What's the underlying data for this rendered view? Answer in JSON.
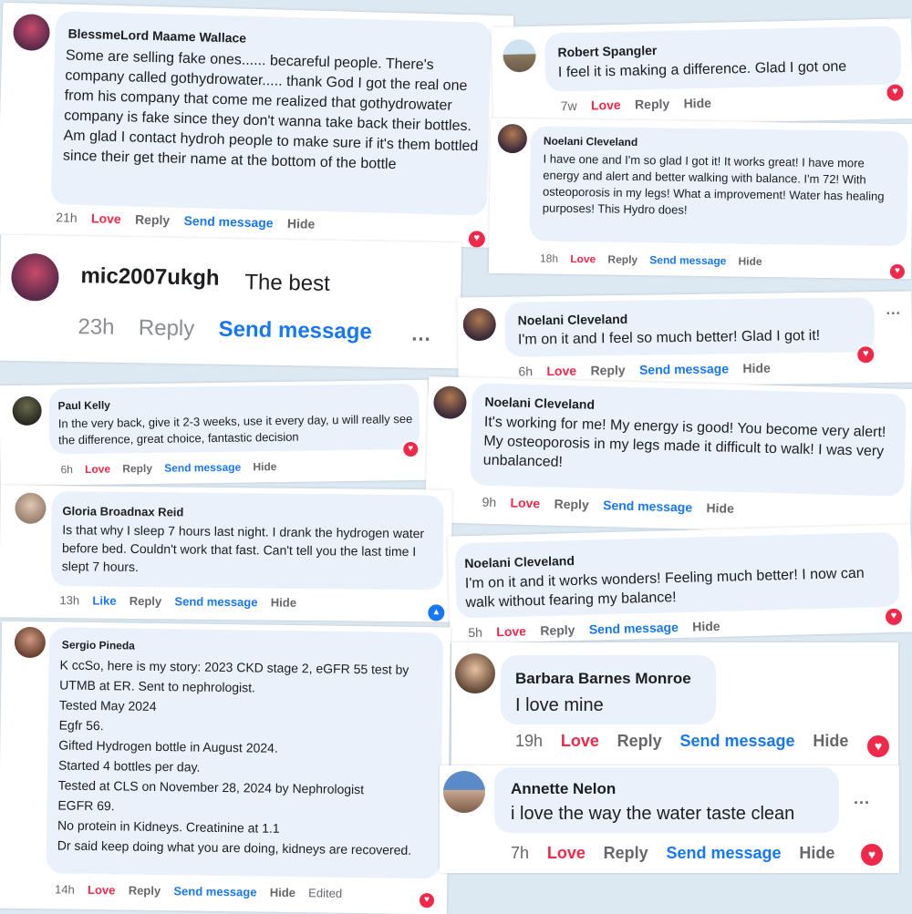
{
  "comments": [
    {
      "name": "BlessmeLord Maame Wallace",
      "text": "Some are selling fake ones...... becareful people. There's company called gothydrowater..... thank God I got the real one from his company that come me realized that gothydrowater company is fake since they don't wanna take back their bottles. Am glad I contact hydroh people to make sure if it's them bottled since their get their name at the bottom of the bottle",
      "time": "21h",
      "react": "Love",
      "reply": "Reply",
      "send": "Send message",
      "hide": "Hide"
    },
    {
      "name": "Robert Spangler",
      "text": "I feel it is making a difference. Glad I got one",
      "time": "7w",
      "react": "Love",
      "reply": "Reply",
      "hide": "Hide"
    },
    {
      "name": "Noelani Cleveland",
      "text": "I have one and I'm so glad I got it! It works great! I have more energy and alert and better walking with balance. I'm 72! With osteoporosis in my legs! What a improvement! Water has healing purposes! This Hydro does!",
      "time": "18h",
      "react": "Love",
      "reply": "Reply",
      "send": "Send message",
      "hide": "Hide"
    },
    {
      "name": "mic2007ukgh",
      "text": "The best",
      "time": "23h",
      "reply": "Reply",
      "send": "Send message",
      "more": "..."
    },
    {
      "name": "Noelani Cleveland",
      "text": "I'm on it and I feel so much better! Glad I got it!",
      "time": "6h",
      "react": "Love",
      "reply": "Reply",
      "send": "Send message",
      "hide": "Hide",
      "more": "..."
    },
    {
      "name": "Paul Kelly",
      "text": "In the very back, give it 2-3 weeks, use it every day, u will really see the difference, great choice, fantastic decision",
      "time": "6h",
      "react": "Love",
      "reply": "Reply",
      "send": "Send message",
      "hide": "Hide"
    },
    {
      "name": "Noelani Cleveland",
      "text": "It's working for me! My energy is good! You become very alert! My osteoporosis in my legs made it difficult to walk! I was very unbalanced!",
      "time": "9h",
      "react": "Love",
      "reply": "Reply",
      "send": "Send message",
      "hide": "Hide"
    },
    {
      "name": "Gloria Broadnax Reid",
      "text": "Is that why I sleep 7 hours last night. I drank the hydrogen water before bed. Couldn't work that fast. Can't tell you the last time I slept 7 hours.",
      "time": "13h",
      "react": "Like",
      "reply": "Reply",
      "send": "Send message",
      "hide": "Hide"
    },
    {
      "name": "Noelani Cleveland",
      "text": "I'm on it and it works wonders! Feeling much better! I now can walk without fearing my balance!",
      "time": "5h",
      "react": "Love",
      "reply": "Reply",
      "send": "Send message",
      "hide": "Hide"
    },
    {
      "name": "Sergio Pineda",
      "lines": [
        "K ccSo, here is my story: 2023 CKD stage 2, eGFR 55 test by UTMB at ER. Sent to nephrologist.",
        "Tested May 2024",
        "Egfr 56.",
        "Gifted Hydrogen bottle in August 2024.",
        "Started 4 bottles per day.",
        "Tested at CLS on November 28, 2024 by Nephrologist",
        "EGFR 69.",
        "No protein in Kidneys. Creatinine at 1.1",
        "Dr said keep doing what you are doing, kidneys are recovered."
      ],
      "time": "14h",
      "react": "Love",
      "reply": "Reply",
      "send": "Send message",
      "hide": "Hide",
      "edited": "Edited"
    },
    {
      "name": "Barbara Barnes Monroe",
      "text": "I love mine",
      "time": "19h",
      "react": "Love",
      "reply": "Reply",
      "send": "Send message",
      "hide": "Hide"
    },
    {
      "name": "Annette Nelon",
      "text": "i love the way the water taste clean",
      "time": "7h",
      "react": "Love",
      "reply": "Reply",
      "send": "Send message",
      "hide": "Hide",
      "more": "..."
    }
  ],
  "colors": {
    "love": "#f0284a",
    "link": "#1877f2",
    "bubble": "#e9f1fb",
    "meta": "#65676b",
    "backdrop": "#dce8f2"
  },
  "icons": {
    "reaction_love": "heart-reaction-icon",
    "reaction_like": "like-reaction-icon",
    "avatar": "avatar"
  }
}
